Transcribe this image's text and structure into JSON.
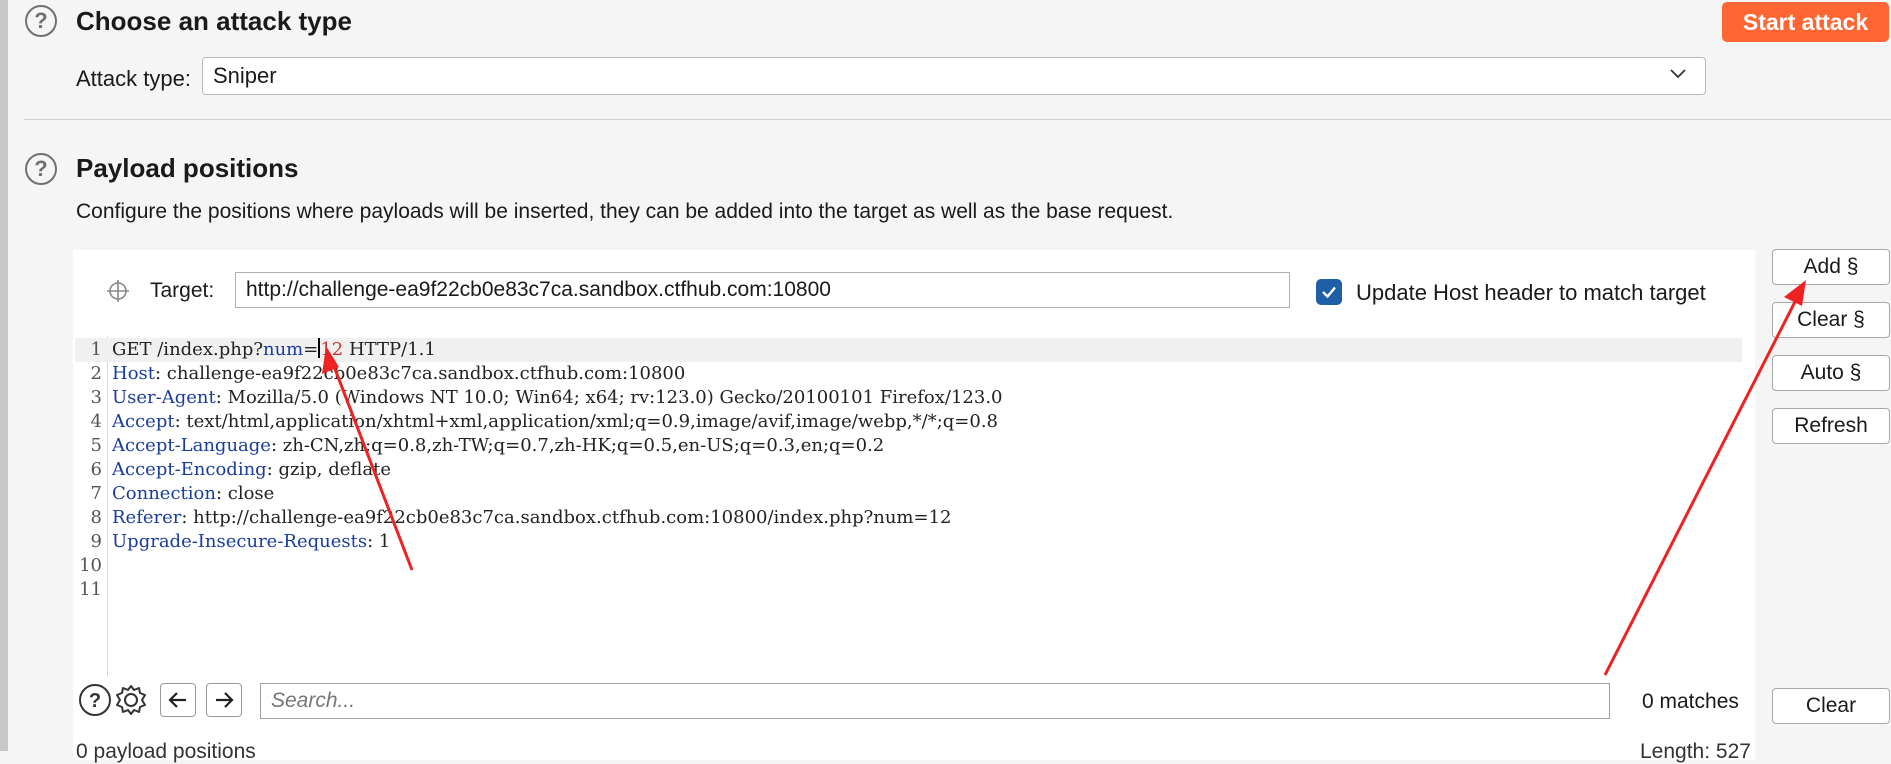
{
  "attack_type_section": {
    "title": "Choose an attack type",
    "start_button": "Start attack",
    "attack_type_label": "Attack type:",
    "attack_type_value": "Sniper"
  },
  "payload_positions": {
    "title": "Payload positions",
    "description": "Configure the positions where payloads will be inserted, they can be added into the target as well as the base request.",
    "target_label": "Target:",
    "target_value": "http://challenge-ea9f22cb0e83c7ca.sandbox.ctfhub.com:10800",
    "update_host_label": "Update Host header to match target",
    "update_host_checked": true,
    "buttons": {
      "add": "Add §",
      "clear": "Clear §",
      "auto": "Auto §",
      "refresh": "Refresh"
    }
  },
  "request": {
    "lines": [
      {
        "n": "1",
        "pre": "GET /index.php?",
        "name": "num",
        "sep": "=",
        "val": "12",
        "post": " HTTP/1.1"
      },
      {
        "n": "2",
        "h": "Host",
        "v": ": challenge-ea9f22cb0e83c7ca.sandbox.ctfhub.com:10800"
      },
      {
        "n": "3",
        "h": "User-Agent",
        "v": ": Mozilla/5.0 (Windows NT 10.0; Win64; x64; rv:123.0) Gecko/20100101 Firefox/123.0"
      },
      {
        "n": "4",
        "h": "Accept",
        "v": ": text/html,application/xhtml+xml,application/xml;q=0.9,image/avif,image/webp,*/*;q=0.8"
      },
      {
        "n": "5",
        "h": "Accept-Language",
        "v": ": zh-CN,zh;q=0.8,zh-TW;q=0.7,zh-HK;q=0.5,en-US;q=0.3,en;q=0.2"
      },
      {
        "n": "6",
        "h": "Accept-Encoding",
        "v": ": gzip, deflate"
      },
      {
        "n": "7",
        "h": "Connection",
        "v": ": close"
      },
      {
        "n": "8",
        "h": "Referer",
        "v": ": http://challenge-ea9f22cb0e83c7ca.sandbox.ctfhub.com:10800/index.php?num=12"
      },
      {
        "n": "9",
        "h": "Upgrade-Insecure-Requests",
        "v": ": 1"
      },
      {
        "n": "10",
        "h": "",
        "v": ""
      },
      {
        "n": "11",
        "h": "",
        "v": ""
      }
    ]
  },
  "search": {
    "placeholder": "Search...",
    "matches": "0 matches",
    "clear_button": "Clear"
  },
  "footer": {
    "left_text": "0 payload positions",
    "right_text": "Length: 527"
  },
  "colors": {
    "accent": "#ff6633",
    "checkbox": "#1f5fa8",
    "annotation_arrow": "#ee2222"
  }
}
